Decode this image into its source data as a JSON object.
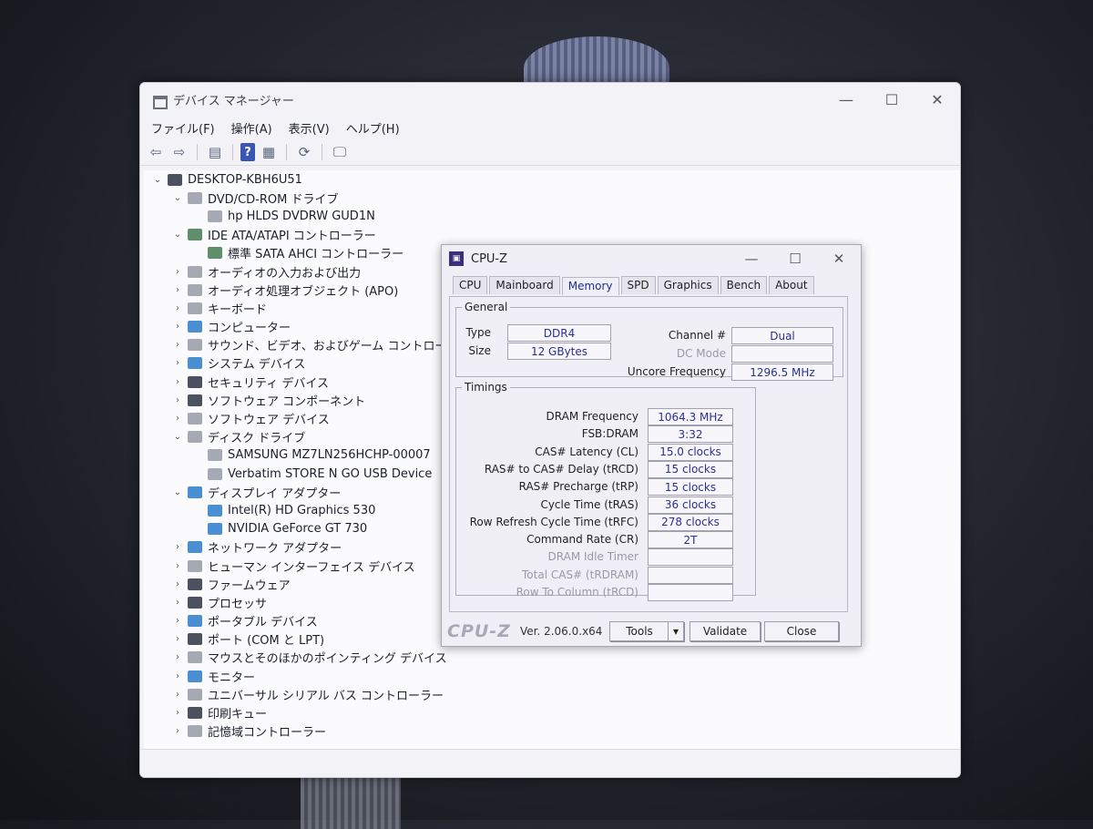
{
  "device_manager": {
    "title": "デバイス マネージャー",
    "window_controls": [
      "—",
      "☐",
      "✕"
    ],
    "menu": [
      "ファイル(F)",
      "操作(A)",
      "表示(V)",
      "ヘルプ(H)"
    ],
    "tree": [
      {
        "label": "DESKTOP-KBH6U51",
        "level": 0,
        "expander": "v",
        "icon": "computer-icon"
      },
      {
        "label": "DVD/CD-ROM ドライブ",
        "level": 1,
        "expander": "v",
        "icon": "dvd-drive-icon"
      },
      {
        "label": "hp HLDS DVDRW  GUD1N",
        "level": 2,
        "expander": "",
        "icon": "dvd-drive-icon"
      },
      {
        "label": "IDE ATA/ATAPI コントローラー",
        "level": 1,
        "expander": "v",
        "icon": "controller-icon"
      },
      {
        "label": "標準 SATA AHCI コントローラー",
        "level": 2,
        "expander": "",
        "icon": "controller-icon"
      },
      {
        "label": "オーディオの入力および出力",
        "level": 1,
        "expander": ">",
        "icon": "speaker-icon"
      },
      {
        "label": "オーディオ処理オブジェクト (APO)",
        "level": 1,
        "expander": ">",
        "icon": "speaker-icon"
      },
      {
        "label": "キーボード",
        "level": 1,
        "expander": ">",
        "icon": "keyboard-icon"
      },
      {
        "label": "コンピューター",
        "level": 1,
        "expander": ">",
        "icon": "monitor-icon"
      },
      {
        "label": "サウンド、ビデオ、およびゲーム コントローラー",
        "level": 1,
        "expander": ">",
        "icon": "speaker-icon"
      },
      {
        "label": "システム デバイス",
        "level": 1,
        "expander": ">",
        "icon": "folder-icon"
      },
      {
        "label": "セキュリティ デバイス",
        "level": 1,
        "expander": ">",
        "icon": "key-icon"
      },
      {
        "label": "ソフトウェア コンポーネント",
        "level": 1,
        "expander": ">",
        "icon": "component-icon"
      },
      {
        "label": "ソフトウェア デバイス",
        "level": 1,
        "expander": ">",
        "icon": "device-icon"
      },
      {
        "label": "ディスク ドライブ",
        "level": 1,
        "expander": "v",
        "icon": "disk-icon"
      },
      {
        "label": "SAMSUNG MZ7LN256HCHP-00007",
        "level": 2,
        "expander": "",
        "icon": "disk-icon"
      },
      {
        "label": "Verbatim STORE N GO USB Device",
        "level": 2,
        "expander": "",
        "icon": "disk-icon"
      },
      {
        "label": "ディスプレイ アダプター",
        "level": 1,
        "expander": "v",
        "icon": "display-adapter-icon"
      },
      {
        "label": "Intel(R) HD Graphics 530",
        "level": 2,
        "expander": "",
        "icon": "display-adapter-icon"
      },
      {
        "label": "NVIDIA GeForce GT 730",
        "level": 2,
        "expander": "",
        "icon": "display-adapter-icon"
      },
      {
        "label": "ネットワーク アダプター",
        "level": 1,
        "expander": ">",
        "icon": "network-icon"
      },
      {
        "label": "ヒューマン インターフェイス デバイス",
        "level": 1,
        "expander": ">",
        "icon": "hid-icon"
      },
      {
        "label": "ファームウェア",
        "level": 1,
        "expander": ">",
        "icon": "firmware-icon"
      },
      {
        "label": "プロセッサ",
        "level": 1,
        "expander": ">",
        "icon": "processor-icon"
      },
      {
        "label": "ポータブル デバイス",
        "level": 1,
        "expander": ">",
        "icon": "portable-icon"
      },
      {
        "label": "ポート (COM と LPT)",
        "level": 1,
        "expander": ">",
        "icon": "port-icon"
      },
      {
        "label": "マウスとそのほかのポインティング デバイス",
        "level": 1,
        "expander": ">",
        "icon": "mouse-icon"
      },
      {
        "label": "モニター",
        "level": 1,
        "expander": ">",
        "icon": "monitor-icon"
      },
      {
        "label": "ユニバーサル シリアル バス コントローラー",
        "level": 1,
        "expander": ">",
        "icon": "usb-icon"
      },
      {
        "label": "印刷キュー",
        "level": 1,
        "expander": ">",
        "icon": "printer-icon"
      },
      {
        "label": "記憶域コントローラー",
        "level": 1,
        "expander": ">",
        "icon": "storage-icon"
      }
    ]
  },
  "cpuz": {
    "title": "CPU-Z",
    "tabs": [
      "CPU",
      "Mainboard",
      "Memory",
      "SPD",
      "Graphics",
      "Bench",
      "About"
    ],
    "active_tab": "Memory",
    "general": {
      "legend": "General",
      "type_label": "Type",
      "type_value": "DDR4",
      "size_label": "Size",
      "size_value": "12 GBytes",
      "channel_label": "Channel #",
      "channel_value": "Dual",
      "dc_mode_label": "DC Mode",
      "dc_mode_value": "",
      "uncore_label": "Uncore Frequency",
      "uncore_value": "1296.5 MHz"
    },
    "timings": {
      "legend": "Timings",
      "rows": [
        {
          "label": "DRAM Frequency",
          "value": "1064.3 MHz",
          "enabled": true
        },
        {
          "label": "FSB:DRAM",
          "value": "3:32",
          "enabled": true
        },
        {
          "label": "CAS# Latency (CL)",
          "value": "15.0 clocks",
          "enabled": true
        },
        {
          "label": "RAS# to CAS# Delay (tRCD)",
          "value": "15 clocks",
          "enabled": true
        },
        {
          "label": "RAS# Precharge (tRP)",
          "value": "15 clocks",
          "enabled": true
        },
        {
          "label": "Cycle Time (tRAS)",
          "value": "36 clocks",
          "enabled": true
        },
        {
          "label": "Row Refresh Cycle Time (tRFC)",
          "value": "278 clocks",
          "enabled": true
        },
        {
          "label": "Command Rate (CR)",
          "value": "2T",
          "enabled": true
        },
        {
          "label": "DRAM Idle Timer",
          "value": "",
          "enabled": false
        },
        {
          "label": "Total CAS# (tRDRAM)",
          "value": "",
          "enabled": false
        },
        {
          "label": "Row To Column (tRCD)",
          "value": "",
          "enabled": false
        }
      ]
    },
    "footer": {
      "brand": "CPU-Z",
      "version": "Ver. 2.06.0.x64",
      "tools": "Tools",
      "tools_arrow": "▾",
      "validate": "Validate",
      "close": "Close"
    }
  }
}
